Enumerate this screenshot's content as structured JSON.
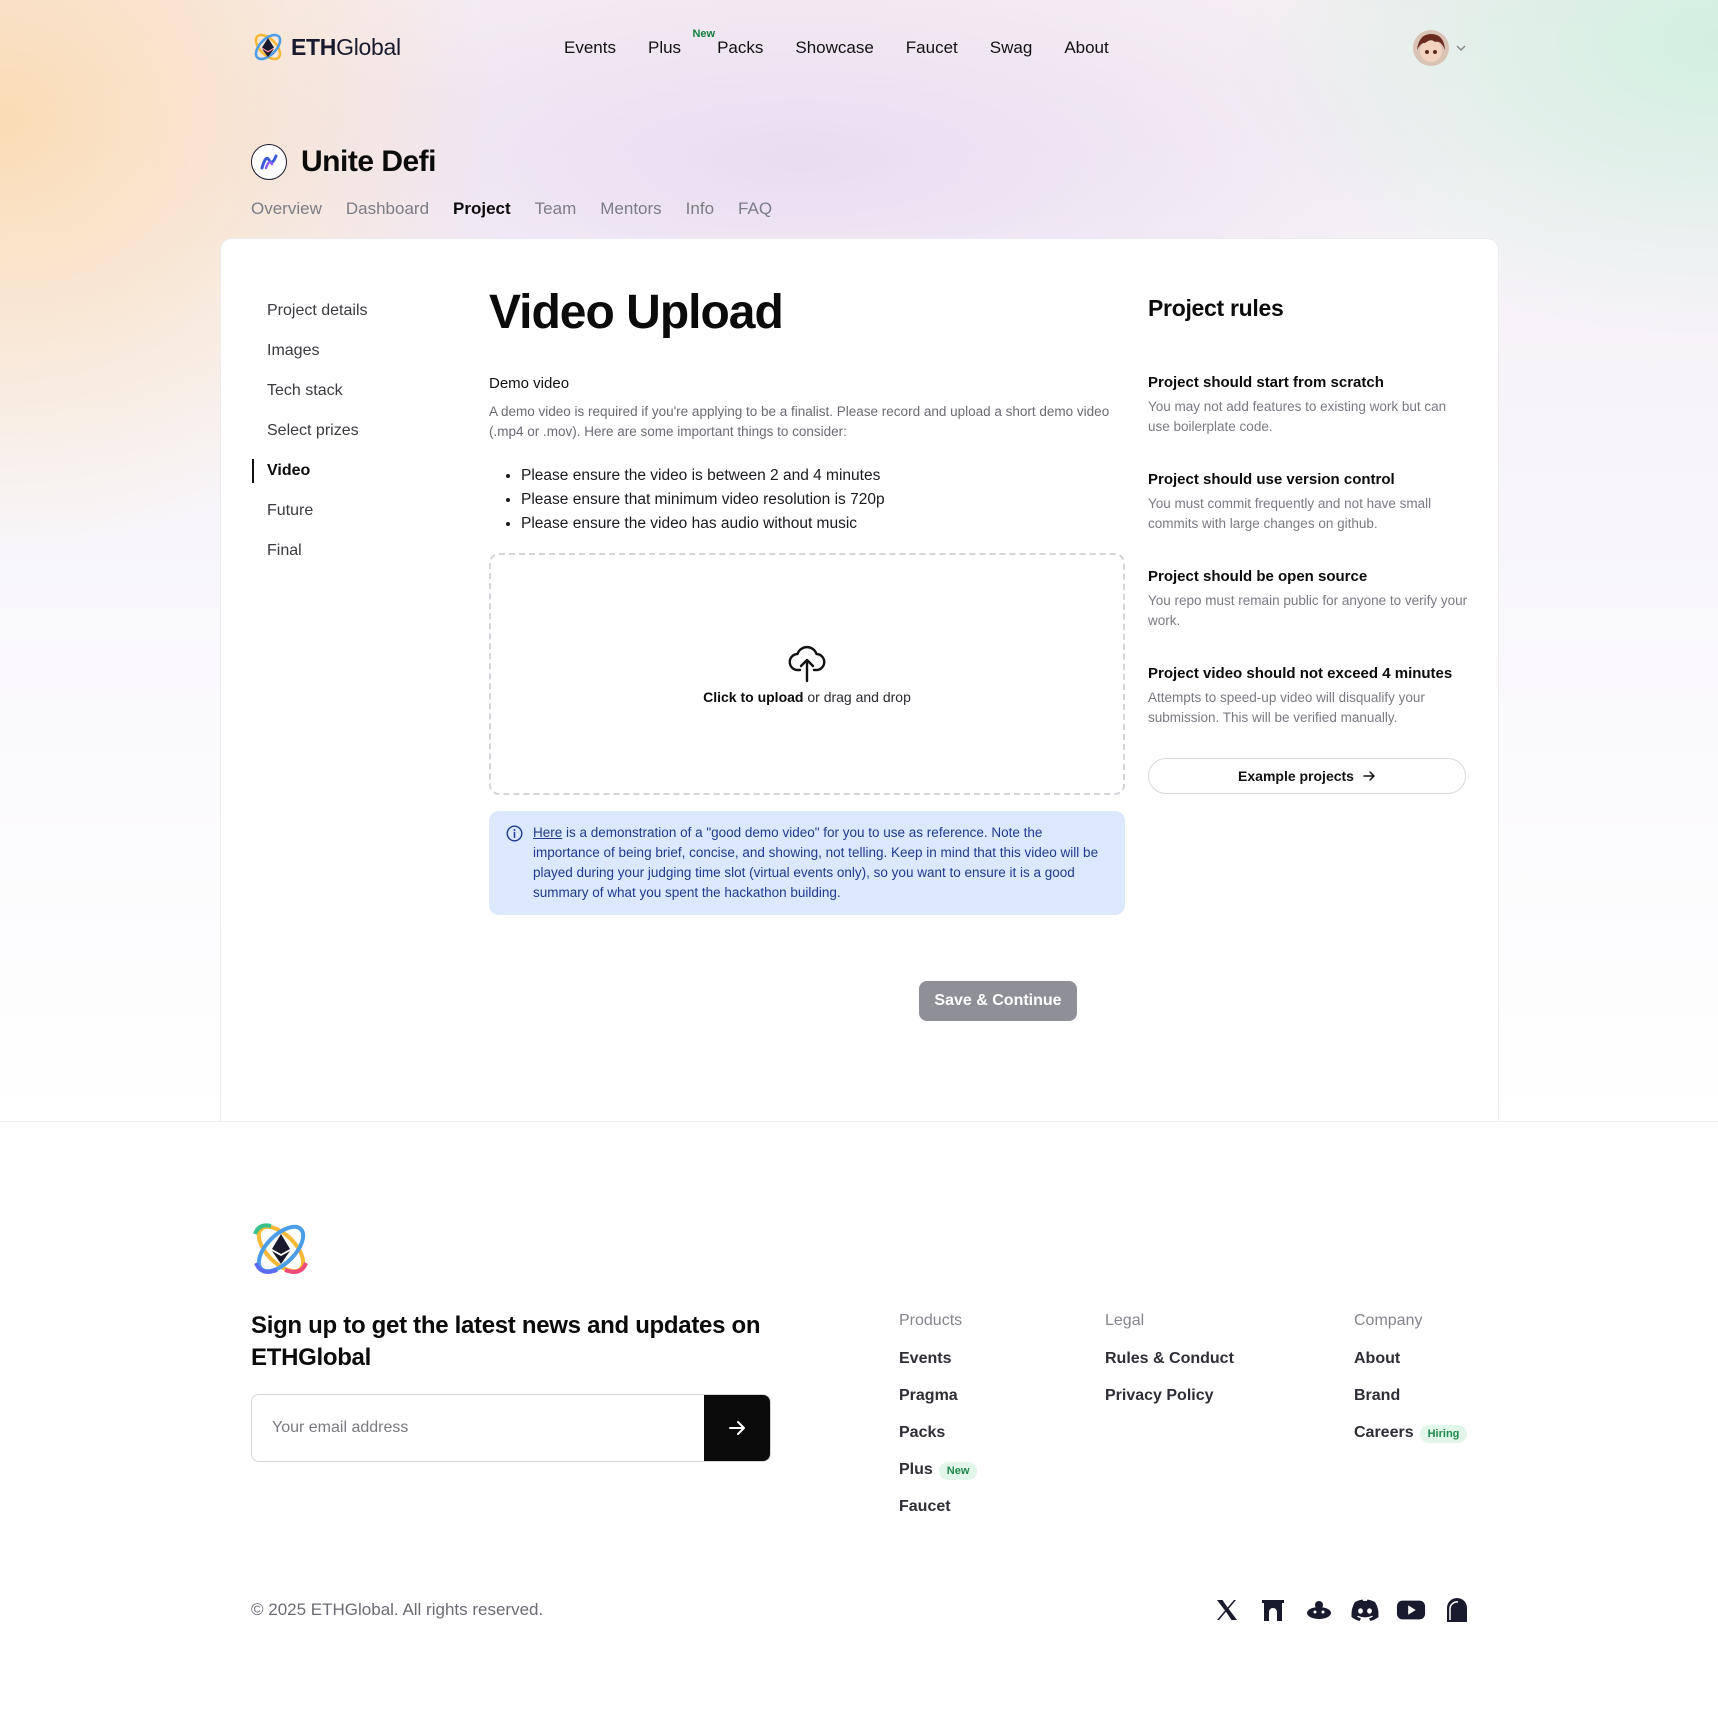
{
  "header": {
    "brand_bold": "ETH",
    "brand_rest": "Global",
    "nav": [
      "Events",
      "Plus",
      "Packs",
      "Showcase",
      "Faucet",
      "Swag",
      "About"
    ],
    "plus_badge": "New"
  },
  "event": {
    "title": "Unite Defi",
    "tabs": [
      "Overview",
      "Dashboard",
      "Project",
      "Team",
      "Mentors",
      "Info",
      "FAQ"
    ],
    "active_tab": "Project"
  },
  "sidenav": {
    "items": [
      "Project details",
      "Images",
      "Tech stack",
      "Select prizes",
      "Video",
      "Future",
      "Final"
    ],
    "active": "Video"
  },
  "main": {
    "heading": "Video Upload",
    "label": "Demo video",
    "description": "A demo video is required if you're applying to be a finalist. Please record and upload a short demo video (.mp4 or .mov). Here are some important things to consider:",
    "bullets": [
      "Please ensure the video is between 2 and 4 minutes",
      "Please ensure that minimum video resolution is 720p",
      "Please ensure the video has audio without music"
    ],
    "upload_bold": "Click to upload",
    "upload_rest": " or drag and drop",
    "info_link": "Here",
    "info_text": " is a demonstration of a \"good demo video\" for you to use as reference. Note the importance of being brief, concise, and showing, not telling. Keep in mind that this video will be played during your judging time slot (virtual events only), so you want to ensure it is a good summary of what you spent the hackathon building.",
    "save_label": "Save & Continue"
  },
  "rules": {
    "title": "Project rules",
    "items": [
      {
        "title": "Project should start from scratch",
        "desc": "You may not add features to existing work but can use boilerplate code."
      },
      {
        "title": "Project should use version control",
        "desc": "You must commit frequently and not have small commits with large changes on github."
      },
      {
        "title": "Project should be open source",
        "desc": "You repo must remain public for anyone to verify your work."
      },
      {
        "title": "Project video should not exceed 4 minutes",
        "desc": "Attempts to speed-up video will disqualify your submission. This will be verified manually."
      }
    ],
    "example_label": "Example projects"
  },
  "footer": {
    "signup": "Sign up to get the latest news and updates on ETHGlobal",
    "email_placeholder": "Your email address",
    "products_head": "Products",
    "products": [
      "Events",
      "Pragma",
      "Packs",
      "Plus",
      "Faucet"
    ],
    "legal_head": "Legal",
    "legal": [
      "Rules & Conduct",
      "Privacy Policy"
    ],
    "company_head": "Company",
    "company": [
      "About",
      "Brand",
      "Careers"
    ],
    "new_badge": "New",
    "hiring_badge": "Hiring",
    "copyright": "© 2025 ETHGlobal. All rights reserved.",
    "socials": [
      "x-icon",
      "farcaster-icon",
      "lens-icon",
      "discord-icon",
      "youtube-icon",
      "ghost-icon"
    ]
  },
  "colors": {
    "accent_dark": "#0b0b0b",
    "save_button_disabled": "#8f8f98",
    "info_bg": "#dbe8fd",
    "info_text": "#213a8f",
    "badge_green": "#1e8a4a"
  }
}
